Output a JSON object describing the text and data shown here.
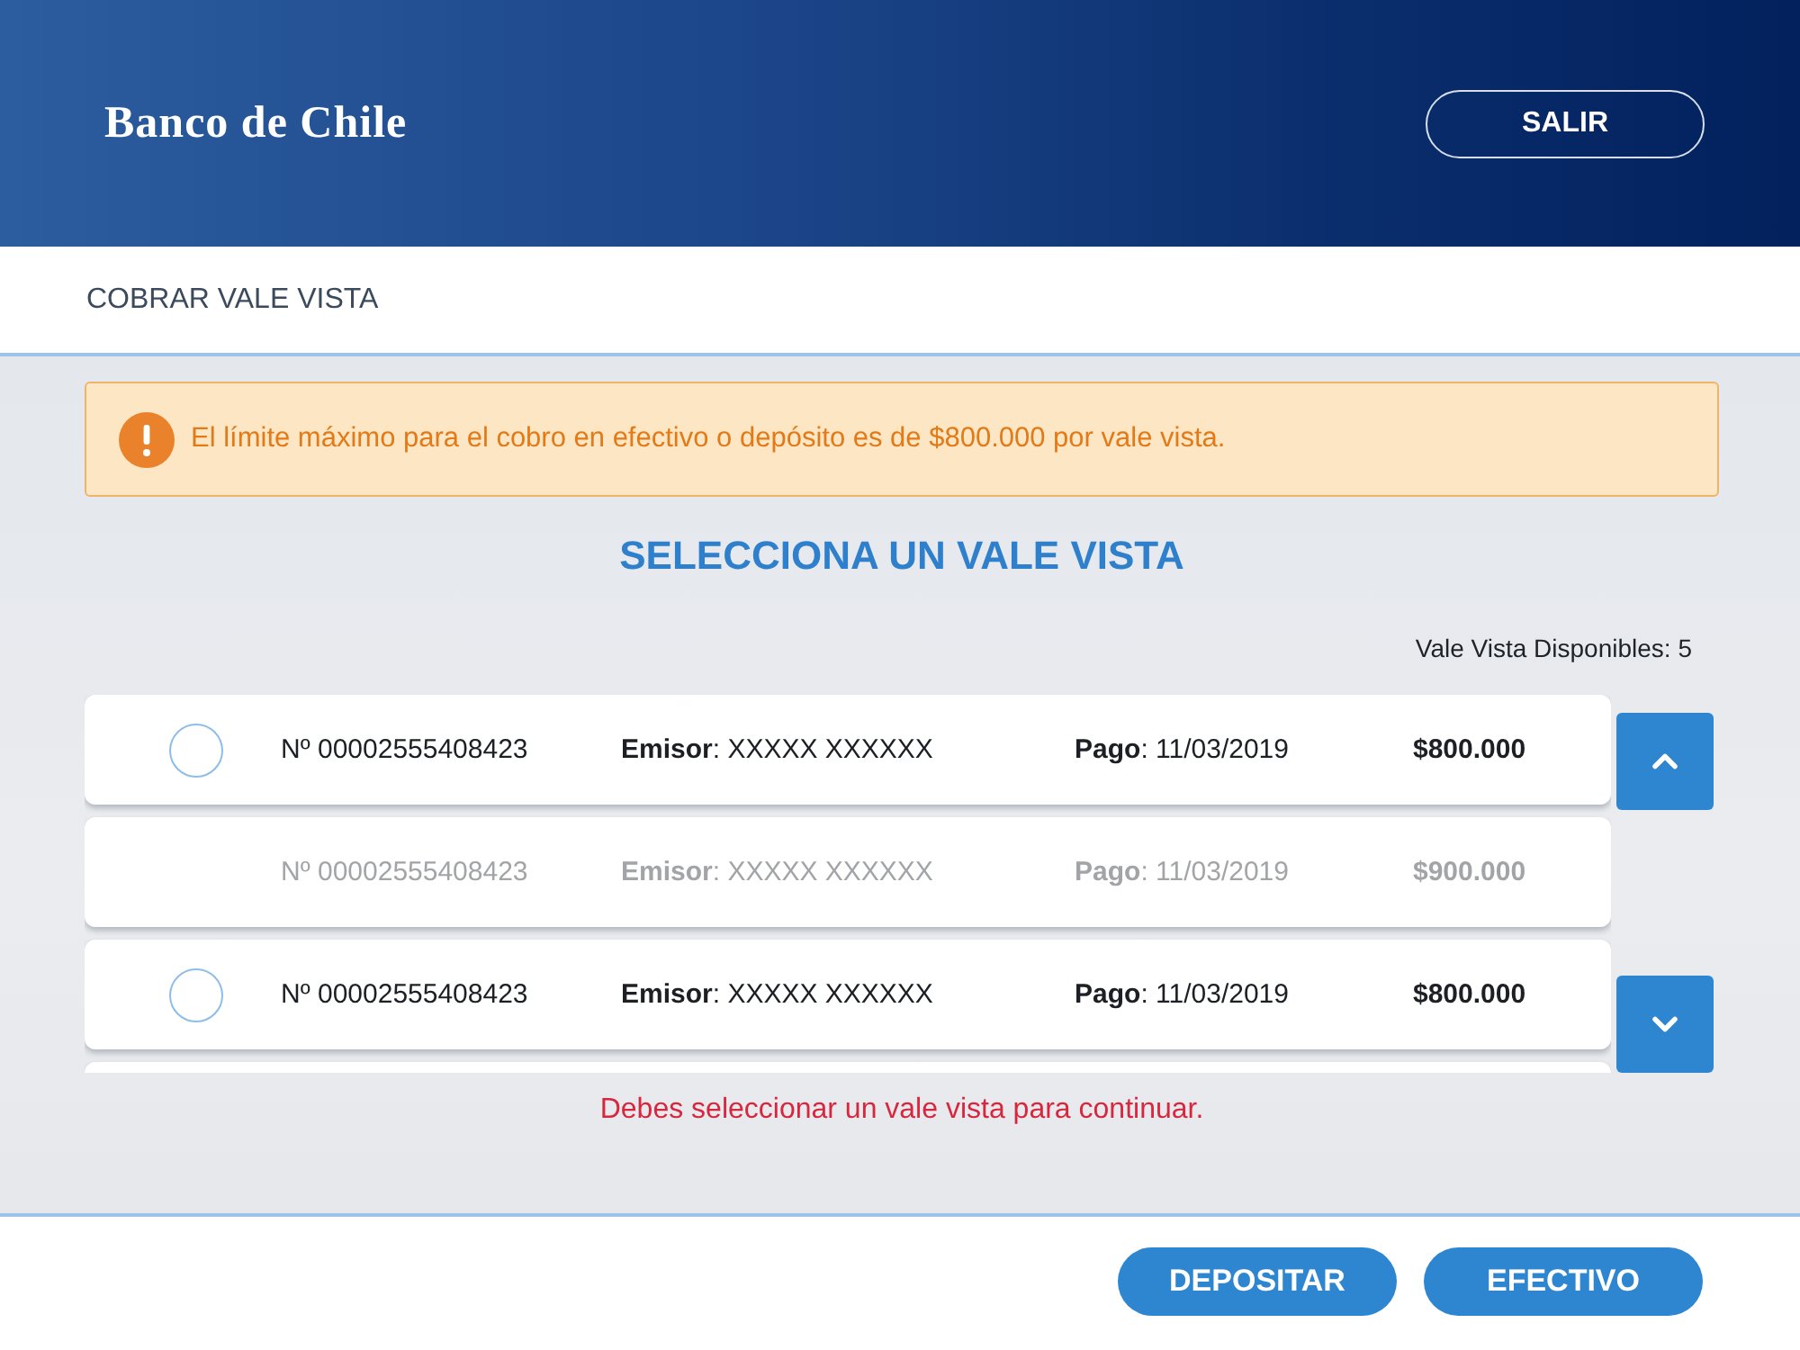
{
  "header": {
    "logo": "Banco de Chile",
    "logout_button": "SALIR"
  },
  "page_title": "COBRAR VALE VISTA",
  "alert": {
    "text": "El límite máximo para el cobro en efectivo o depósito es de $800.000 por vale vista."
  },
  "heading": "SELECCIONA UN VALE VISTA",
  "available_count": "Vale Vista Disponibles: 5",
  "vouchers": [
    {
      "number": "Nº 00002555408423",
      "issuer": "**Emisor**: XXXXX XXXXXX",
      "payment": "**Pago**: 11/03/2019",
      "amount": "$800.000",
      "disabled": false,
      "selected": false
    },
    {
      "number": "Nº 00002555408423",
      "issuer": "**Emisor**: XXXXX XXXXXX",
      "payment": "**Pago**: 11/03/2019",
      "amount": "$900.000",
      "disabled": true,
      "selected": false
    },
    {
      "number": "Nº 00002555408423",
      "issuer": "**Emisor**: XXXXX XXXXXX",
      "payment": "**Pago**: 11/03/2019",
      "amount": "$800.000",
      "disabled": false,
      "selected": false
    }
  ],
  "error": "Debes seleccionar un vale vista para continuar.",
  "actions": [
    "DEPOSITAR",
    "EFECTIVO"
  ]
}
